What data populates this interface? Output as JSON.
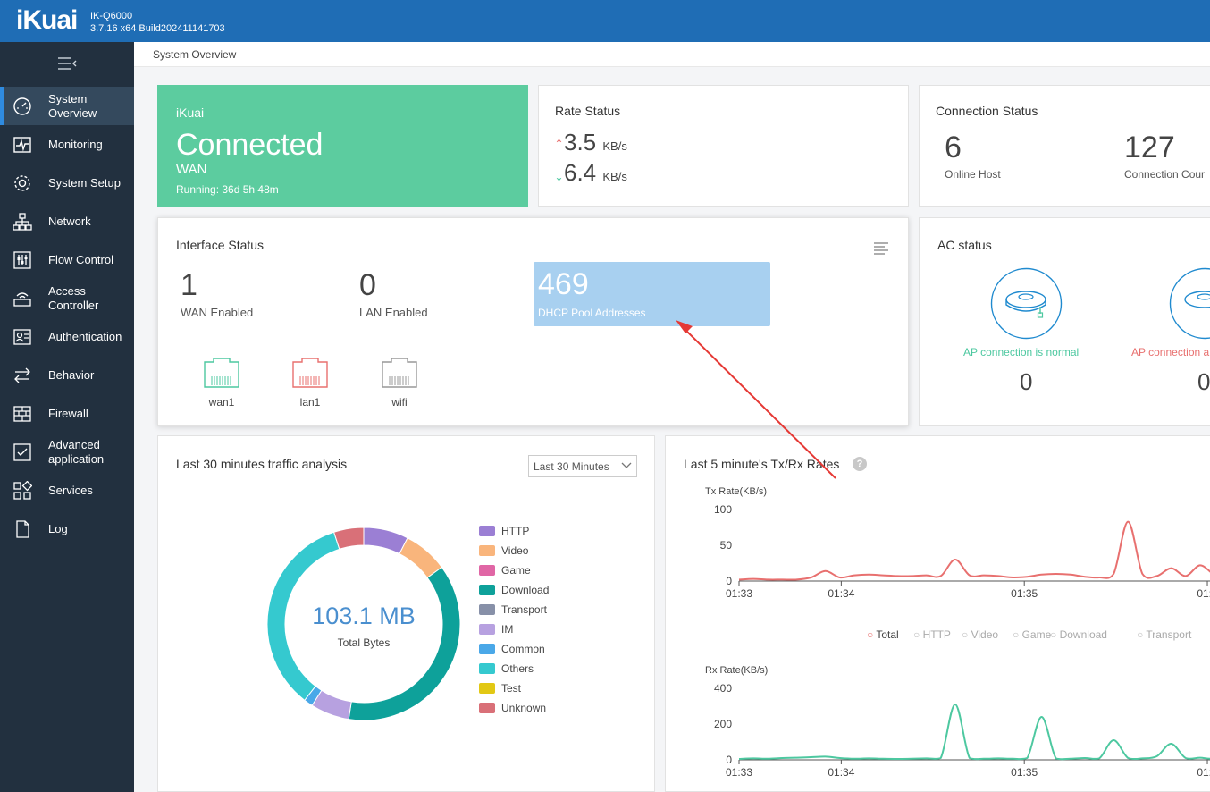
{
  "header": {
    "logo": "iKuai",
    "model": "IK-Q6000",
    "build": "3.7.16 x64 Build202411141703"
  },
  "sidebar": {
    "items": [
      {
        "label": "System Overview",
        "icon": "gauge-icon"
      },
      {
        "label": "Monitoring",
        "icon": "pulse-icon"
      },
      {
        "label": "System Setup",
        "icon": "gear-icon"
      },
      {
        "label": "Network",
        "icon": "network-icon"
      },
      {
        "label": "Flow Control",
        "icon": "sliders-icon"
      },
      {
        "label": "Access Controller",
        "icon": "wifi-box-icon"
      },
      {
        "label": "Authentication",
        "icon": "id-card-icon"
      },
      {
        "label": "Behavior",
        "icon": "arrows-icon"
      },
      {
        "label": "Firewall",
        "icon": "brick-wall-icon"
      },
      {
        "label": "Advanced application",
        "icon": "checklist-icon"
      },
      {
        "label": "Services",
        "icon": "grid-icon"
      },
      {
        "label": "Log",
        "icon": "document-icon"
      }
    ]
  },
  "breadcrumb": "System Overview",
  "status_card": {
    "brand": "iKuai",
    "state": "Connected",
    "link": "WAN",
    "running": "Running: 36d 5h 48m"
  },
  "rate_status": {
    "title": "Rate Status",
    "up_value": "3.5",
    "down_value": "6.4",
    "unit": "KB/s"
  },
  "connection_status": {
    "title": "Connection Status",
    "online_host_value": "6",
    "online_host_label": "Online Host",
    "connection_count_value": "127",
    "connection_count_label": "Connection Cour"
  },
  "interface_status": {
    "title": "Interface Status",
    "wan_value": "1",
    "wan_label": "WAN Enabled",
    "lan_value": "0",
    "lan_label": "LAN Enabled",
    "dhcp_value": "469",
    "dhcp_label": "DHCP Pool Addresses",
    "ports": [
      "wan1",
      "lan1",
      "wifi"
    ]
  },
  "ac_status": {
    "title": "AC status",
    "normal_label": "AP connection is normal",
    "normal_count": "0",
    "abnormal_label": "AP connection a",
    "abnormal_count": "0"
  },
  "traffic": {
    "title": "Last 30 minutes traffic analysis",
    "range_select": "Last 30 Minutes",
    "total_value": "103.1 MB",
    "total_label": "Total Bytes"
  },
  "rates_chart": {
    "title": "Last 5 minute's Tx/Rx Rates",
    "help_symbol": "?",
    "tx_label": "Tx Rate(KB/s)",
    "rx_label": "Rx Rate(KB/s)",
    "legend": [
      "Total",
      "HTTP",
      "Video",
      "Game",
      "Download",
      "Transport"
    ]
  },
  "colors": {
    "accent": "#1f6db5",
    "green": "#5ccc9f",
    "tx_line": "#e8706f",
    "rx_line": "#4dc8a0",
    "dhcp_bg": "#a8d0f0"
  },
  "chart_data": [
    {
      "type": "pie",
      "title": "",
      "center_value": "103.1 MB",
      "center_label": "Total Bytes",
      "categories": [
        "HTTP",
        "Video",
        "Game",
        "Download",
        "Transport",
        "IM",
        "Common",
        "Others",
        "Test",
        "Unknown"
      ],
      "values": [
        7.5,
        7.5,
        0,
        37.5,
        0,
        6.5,
        1.5,
        34.5,
        0,
        5.0
      ],
      "colors": [
        "#9b7fd4",
        "#f9b57c",
        "#e066a5",
        "#0ea19a",
        "#8790a8",
        "#b7a1e0",
        "#4aa8e8",
        "#35c9cf",
        "#e2c814",
        "#d97078"
      ],
      "legend_position": "right"
    },
    {
      "type": "line",
      "title": "",
      "ylabel": "Tx Rate(KB/s)",
      "ylim": [
        0,
        100
      ],
      "yticks": [
        0,
        50,
        100
      ],
      "xticks": [
        "01:33",
        "01:34",
        "01:35",
        "01:3"
      ],
      "x": [
        0,
        5,
        10,
        15,
        20,
        25,
        30,
        35,
        40,
        45,
        50,
        55,
        60,
        65,
        70,
        75,
        80,
        85,
        90,
        95,
        100,
        105,
        110,
        115,
        120,
        125,
        130,
        135,
        140,
        145,
        150,
        155,
        160,
        165,
        170,
        175,
        180
      ],
      "series": [
        {
          "name": "Total",
          "values": [
            2,
            3,
            2,
            2,
            2,
            5,
            14,
            5,
            8,
            9,
            8,
            7,
            7,
            8,
            7,
            30,
            8,
            8,
            7,
            5,
            6,
            9,
            10,
            9,
            6,
            5,
            10,
            83,
            10,
            7,
            18,
            7,
            22,
            9,
            5,
            7,
            4
          ]
        }
      ],
      "grid": false
    },
    {
      "type": "line",
      "title": "",
      "ylabel": "Rx Rate(KB/s)",
      "ylim": [
        0,
        400
      ],
      "yticks": [
        0,
        200,
        400
      ],
      "xticks": [
        "01:33",
        "01:34",
        "01:35",
        "01:3"
      ],
      "x": [
        0,
        5,
        10,
        15,
        20,
        25,
        30,
        35,
        40,
        45,
        50,
        55,
        60,
        65,
        70,
        75,
        80,
        85,
        90,
        95,
        100,
        105,
        110,
        115,
        120,
        125,
        130,
        135,
        140,
        145,
        150,
        155,
        160,
        165,
        170,
        175,
        180
      ],
      "series": [
        {
          "name": "Total",
          "values": [
            5,
            8,
            6,
            10,
            12,
            15,
            18,
            10,
            6,
            8,
            6,
            5,
            6,
            8,
            10,
            310,
            10,
            6,
            8,
            6,
            10,
            240,
            8,
            6,
            10,
            8,
            110,
            10,
            8,
            20,
            90,
            10,
            12,
            10,
            80,
            120,
            115
          ]
        }
      ],
      "grid": false
    }
  ]
}
